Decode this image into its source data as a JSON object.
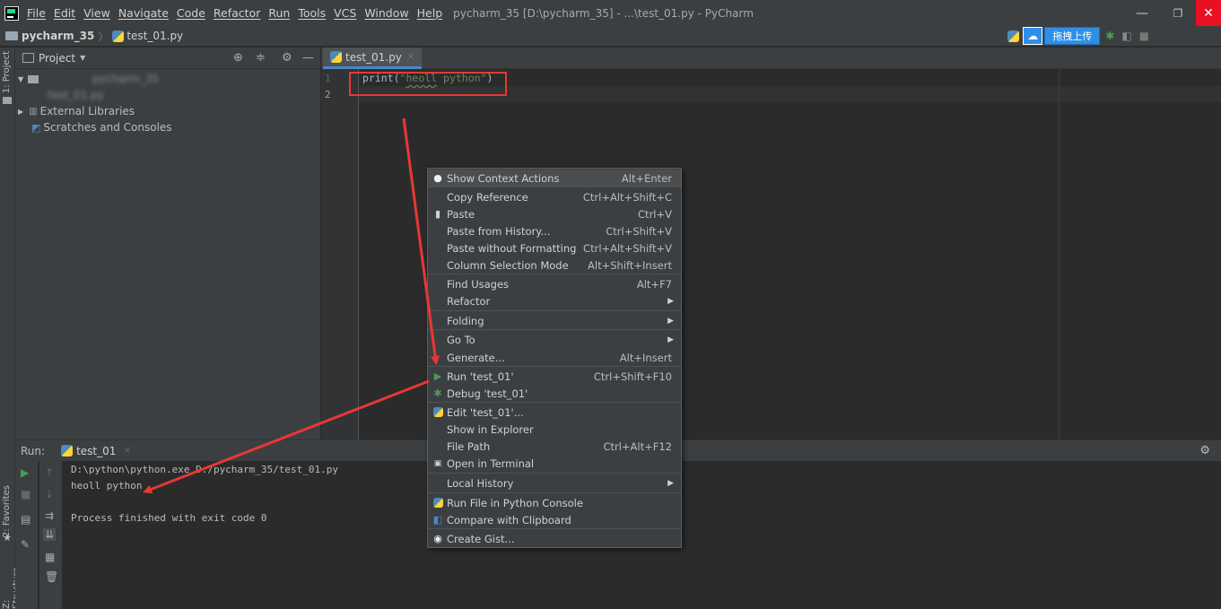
{
  "title_bar": {
    "menus": [
      "File",
      "Edit",
      "View",
      "Navigate",
      "Code",
      "Refactor",
      "Run",
      "Tools",
      "VCS",
      "Window",
      "Help"
    ],
    "window_title": "pycharm_35 [D:\\pycharm_35] - ...\\test_01.py - PyCharm",
    "minimize": "—",
    "maximize": "❐",
    "close": "✕"
  },
  "nav_bar": {
    "project": "pycharm_35",
    "separator": "〉",
    "file": "test_01.py",
    "upload_label": "拖拽上传"
  },
  "left_strip": {
    "project_tab": "1: Project",
    "favorites_tab": "2: Favorites",
    "structure_tab": "Z: Structure"
  },
  "project_panel": {
    "title": "Project",
    "tree": [
      {
        "label": "pycharm_35",
        "blurred": true
      },
      {
        "label": "test_01.py",
        "blurred": true
      },
      {
        "label": "External Libraries",
        "blurred": false
      },
      {
        "label": "Scratches and Consoles",
        "blurred": false
      }
    ]
  },
  "editor": {
    "tab": "test_01.py",
    "line_numbers": [
      "1",
      "2"
    ],
    "code": {
      "fn": "print(",
      "str_open": "\"",
      "str_word1": "heoll",
      "str_rest": " python\"",
      "close": ")"
    }
  },
  "run_panel": {
    "label": "Run:",
    "tab": "test_01",
    "lines": [
      "D:\\python\\python.exe D:/pycharm_35/test_01.py",
      "heoll python",
      "",
      "Process finished with exit code 0"
    ]
  },
  "context_menu": {
    "items": [
      {
        "label": "Show Context Actions",
        "shortcut": "Alt+Enter",
        "icon": "bulb-icon"
      },
      {
        "label": "Copy Reference",
        "shortcut": "Ctrl+Alt+Shift+C"
      },
      {
        "label": "Paste",
        "shortcut": "Ctrl+V",
        "icon": "clipboard-icon"
      },
      {
        "label": "Paste from History...",
        "shortcut": "Ctrl+Shift+V"
      },
      {
        "label": "Paste without Formatting",
        "shortcut": "Ctrl+Alt+Shift+V"
      },
      {
        "label": "Column Selection Mode",
        "shortcut": "Alt+Shift+Insert"
      },
      {
        "label": "Find Usages",
        "shortcut": "Alt+F7"
      },
      {
        "label": "Refactor",
        "submenu": true
      },
      {
        "label": "Folding",
        "submenu": true
      },
      {
        "label": "Go To",
        "submenu": true
      },
      {
        "label": "Generate...",
        "shortcut": "Alt+Insert"
      },
      {
        "label": "Run 'test_01'",
        "shortcut": "Ctrl+Shift+F10",
        "icon": "run-icon"
      },
      {
        "label": "Debug 'test_01'",
        "icon": "debug-icon"
      },
      {
        "label": "Edit 'test_01'...",
        "icon": "python-icon"
      },
      {
        "label": "Show in Explorer"
      },
      {
        "label": "File Path",
        "shortcut": "Ctrl+Alt+F12"
      },
      {
        "label": "Open in Terminal",
        "icon": "terminal-icon"
      },
      {
        "label": "Local History",
        "submenu": true
      },
      {
        "label": "Run File in Python Console",
        "icon": "python-icon"
      },
      {
        "label": "Compare with Clipboard",
        "icon": "compare-icon"
      },
      {
        "label": "Create Gist...",
        "icon": "github-icon"
      }
    ]
  },
  "colors": {
    "annotation": "#e53935",
    "run_green": "#499c54",
    "accent": "#4a88c7"
  }
}
